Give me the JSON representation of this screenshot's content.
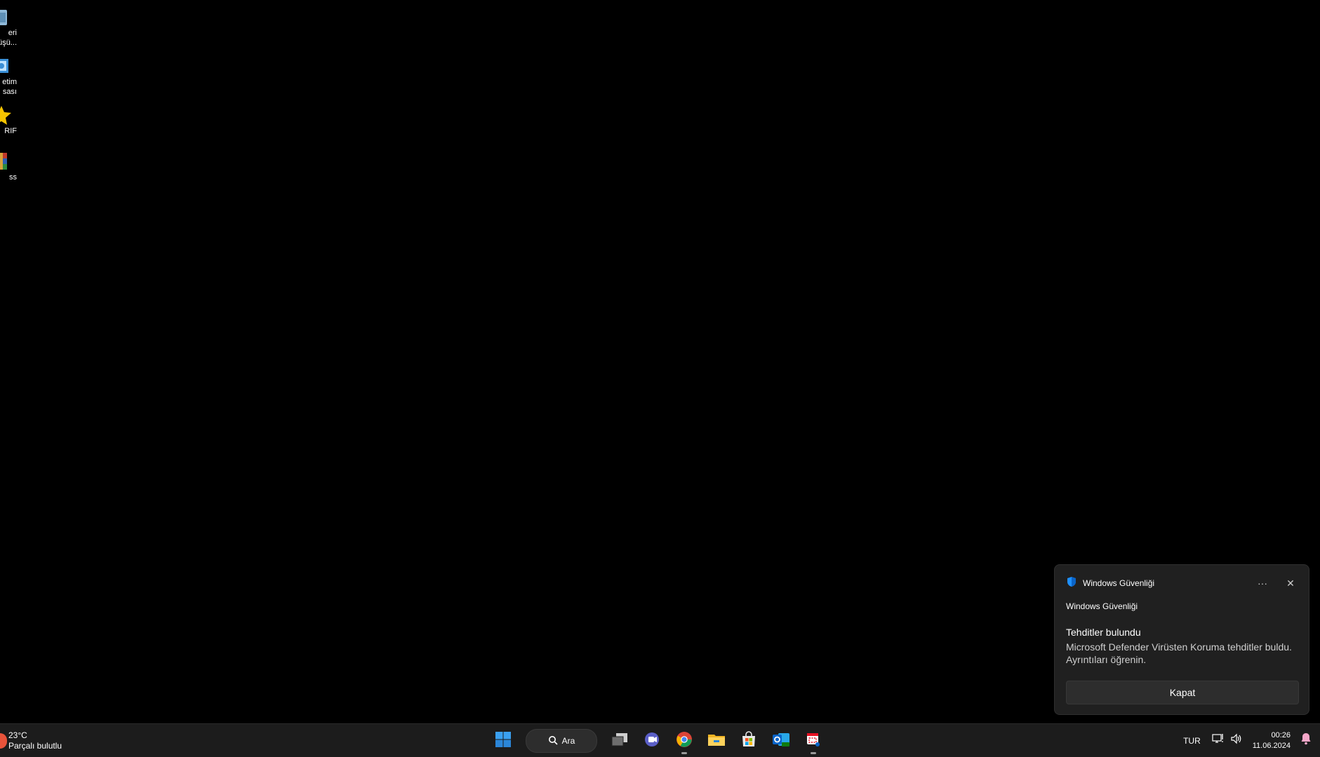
{
  "desktop": {
    "icons": [
      {
        "label": "eri\nüşü...",
        "icon": "recycle-bin-icon"
      },
      {
        "label": "etim\nsası",
        "icon": "control-panel-icon"
      },
      {
        "label": "RIF",
        "icon": "star-shortcut-icon"
      },
      {
        "label": "ss",
        "icon": "winrar-icon"
      }
    ]
  },
  "taskbar": {
    "weather": {
      "temp": "23°C",
      "condition": "Parçalı bulutlu"
    },
    "search_label": "Ara",
    "apps": [
      "start-icon",
      "search",
      "task-view-icon",
      "teams-icon",
      "chrome-icon",
      "file-explorer-icon",
      "store-icon",
      "outlook-icon",
      "snipping-tool-icon"
    ],
    "language": "TUR",
    "time": "00:26",
    "date": "11.06.2024"
  },
  "toast": {
    "app_name": "Windows Güvenliği",
    "subheader": "Windows Güvenliği",
    "title": "Tehditler bulundu",
    "body": "Microsoft Defender Virüsten Koruma tehditler buldu. Ayrıntıları öğrenin.",
    "more_label": "···",
    "close_label": "✕",
    "button_label": "Kapat",
    "accent": "#1e90ff"
  }
}
